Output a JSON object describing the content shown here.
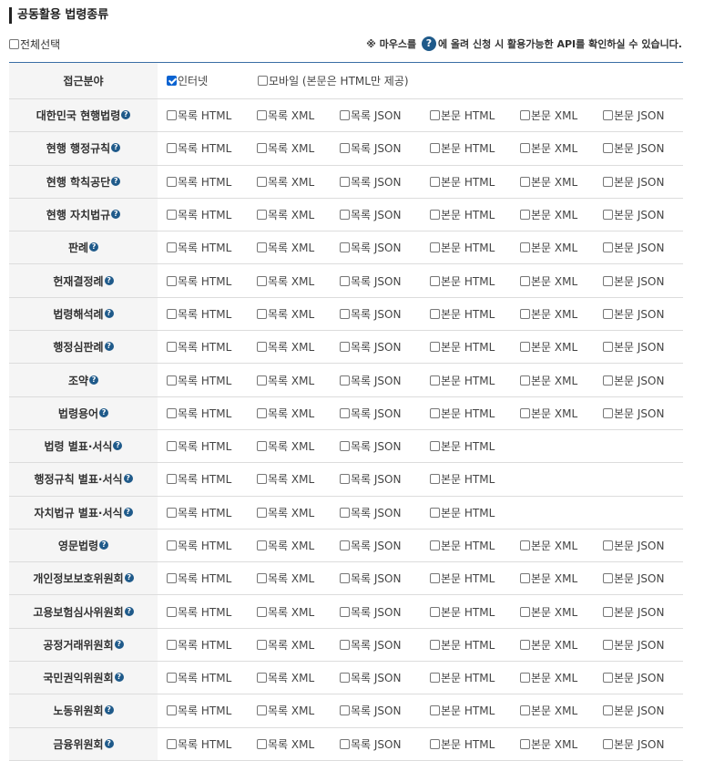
{
  "title": "공동활용 법령종류",
  "select_all_label": "전체선택",
  "notice": {
    "prefix": "※ 마우스를",
    "icon": "?",
    "suffix": "에 올려 신청 시 활용가능한 API를 확인하실 수 있습니다."
  },
  "access": {
    "label": "접근분야",
    "options": [
      {
        "label": "인터넷",
        "checked": true
      },
      {
        "label": "모바일 (본문은 HTML만 제공)",
        "checked": false
      }
    ]
  },
  "help_icon": "?",
  "option_labels": [
    "목록 HTML",
    "목록 XML",
    "목록 JSON",
    "본문 HTML",
    "본문 XML",
    "본문 JSON"
  ],
  "rows": [
    {
      "label": "대한민국 현행법령",
      "option_count": 6
    },
    {
      "label": "현행 행정규칙",
      "option_count": 6
    },
    {
      "label": "현행 학칙공단",
      "option_count": 6
    },
    {
      "label": "현행 자치법규",
      "option_count": 6
    },
    {
      "label": "판례",
      "option_count": 6
    },
    {
      "label": "헌재결정례",
      "option_count": 6
    },
    {
      "label": "법령해석례",
      "option_count": 6
    },
    {
      "label": "행정심판례",
      "option_count": 6
    },
    {
      "label": "조약",
      "option_count": 6
    },
    {
      "label": "법령용어",
      "option_count": 6
    },
    {
      "label": "법령 별표·서식",
      "option_count": 4
    },
    {
      "label": "행정규칙 별표·서식",
      "option_count": 4
    },
    {
      "label": "자치법규 별표·서식",
      "option_count": 4
    },
    {
      "label": "영문법령",
      "option_count": 6
    },
    {
      "label": "개인정보보호위원회",
      "option_count": 6
    },
    {
      "label": "고용보험심사위원회",
      "option_count": 6
    },
    {
      "label": "공정거래위원회",
      "option_count": 6
    },
    {
      "label": "국민권익위원회",
      "option_count": 6
    },
    {
      "label": "노동위원회",
      "option_count": 6
    },
    {
      "label": "금융위원회",
      "option_count": 6
    }
  ]
}
